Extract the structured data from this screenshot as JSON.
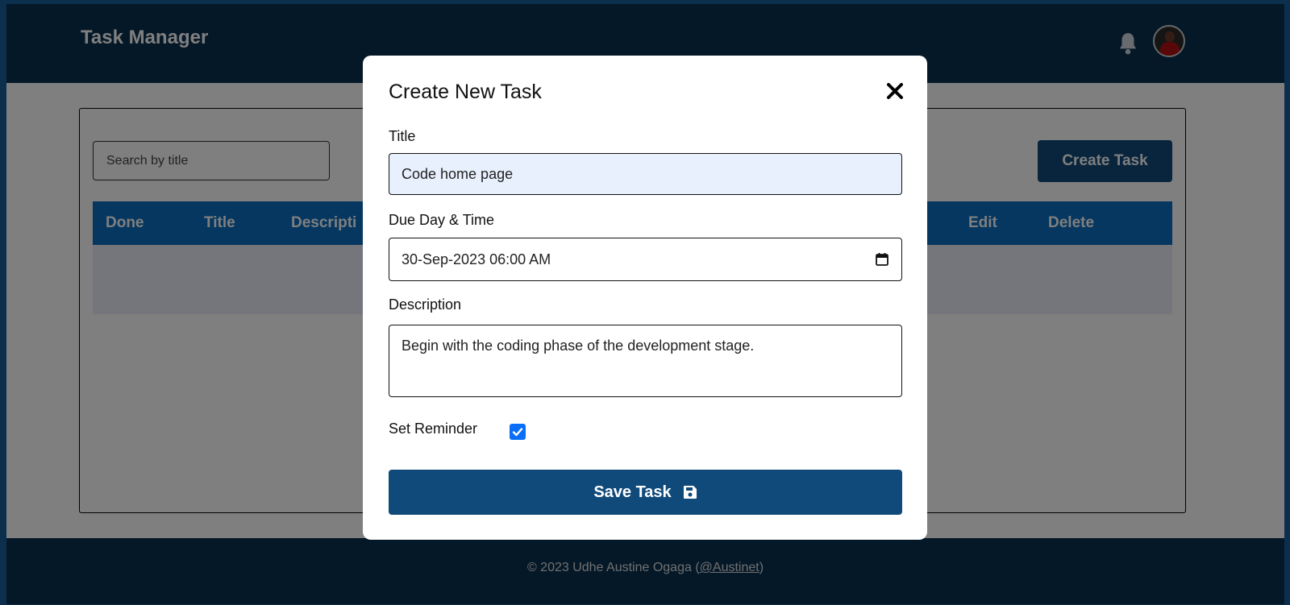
{
  "app": {
    "title": "Task Manager"
  },
  "header": {
    "bell_icon": "bell-icon",
    "avatar": "user-avatar"
  },
  "search": {
    "placeholder": "Search by title"
  },
  "toolbar": {
    "create_label": "Create Task"
  },
  "table": {
    "columns": [
      "Done",
      "Title",
      "Descripti",
      "Edit",
      "Delete"
    ]
  },
  "footer": {
    "prefix": "© 2023 Udhe Austine Ogaga (",
    "handle": "@Austinet",
    "suffix": ")"
  },
  "modal": {
    "title": "Create New Task",
    "close_icon": "close-icon",
    "title_label": "Title",
    "title_value": "Code home page",
    "due_label": "Due Day & Time",
    "due_value": "30-Sep-2023 06:00 AM",
    "description_label": "Description",
    "description_value": "Begin with the coding phase of the development stage.",
    "reminder_label": "Set Reminder",
    "reminder_checked": true,
    "save_label": "Save Task",
    "save_icon": "floppy-disk-icon"
  },
  "colors": {
    "header": "#0a3050",
    "accent": "#104a7a",
    "table_header": "#0a6fc0",
    "checkbox": "#0b6ef8"
  }
}
